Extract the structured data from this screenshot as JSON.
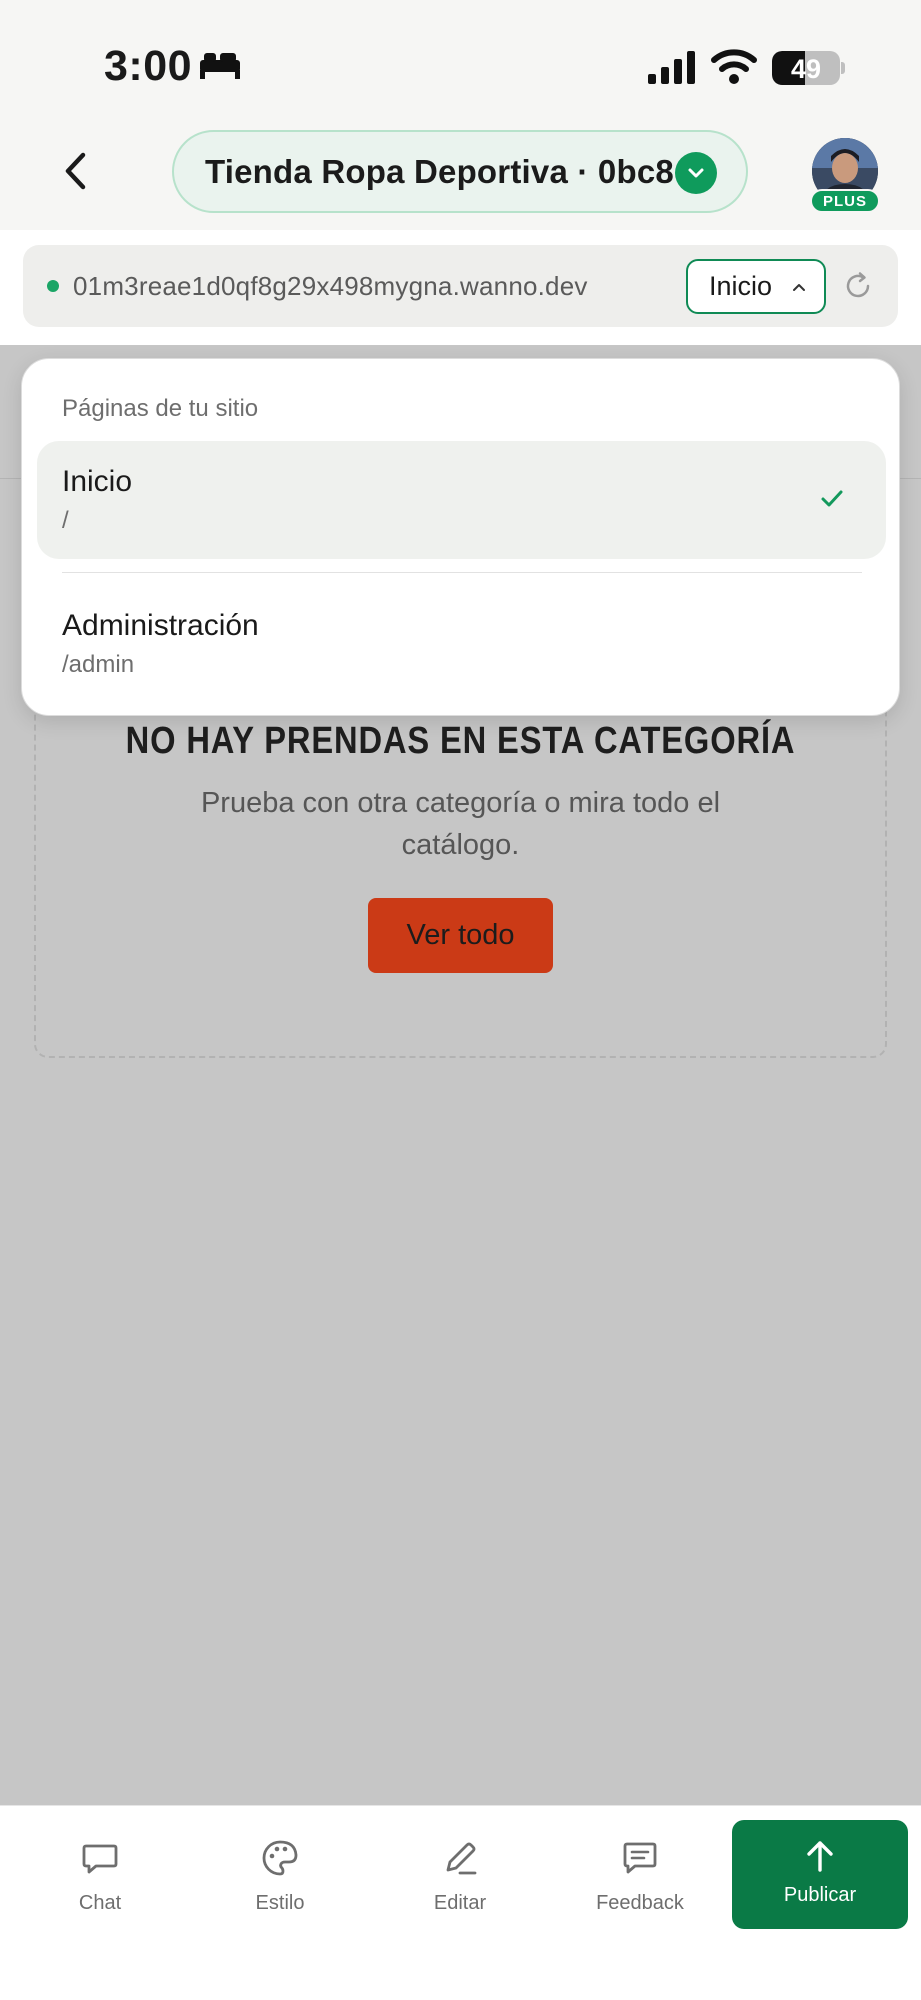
{
  "status_bar": {
    "time": "3:00",
    "battery_level": "49",
    "battery_fraction": 0.49
  },
  "header": {
    "project_name": "Tienda Ropa Deportiva · 0bc8",
    "badge": "PLUS"
  },
  "url_bar": {
    "url": "01m3reae1d0qf8g29x498mygna.wanno.dev",
    "page_selector": "Inicio"
  },
  "dropdown": {
    "title": "Páginas de tu sitio",
    "pages": [
      {
        "name": "Inicio",
        "path": "/",
        "selected": true
      },
      {
        "name": "Administración",
        "path": "/admin",
        "selected": false
      }
    ]
  },
  "preview": {
    "empty_title": "NO HAY PRENDAS EN ESTA CATEGORÍA",
    "empty_subtitle": "Prueba con otra categoría o mira todo el catálogo.",
    "button_label": "Ver todo"
  },
  "bottom_nav": {
    "items": [
      {
        "label": "Chat",
        "icon": "chat-bubble-icon"
      },
      {
        "label": "Estilo",
        "icon": "palette-icon"
      },
      {
        "label": "Editar",
        "icon": "pencil-icon"
      },
      {
        "label": "Feedback",
        "icon": "message-square-icon"
      }
    ],
    "publish_label": "Publicar",
    "publish_icon": "arrow-up-icon"
  },
  "colors": {
    "accent_green": "#0f9b5c",
    "publish_green": "#0a7a46",
    "cta_orange": "#cb3a16",
    "backdrop": "#c6c6c6"
  }
}
